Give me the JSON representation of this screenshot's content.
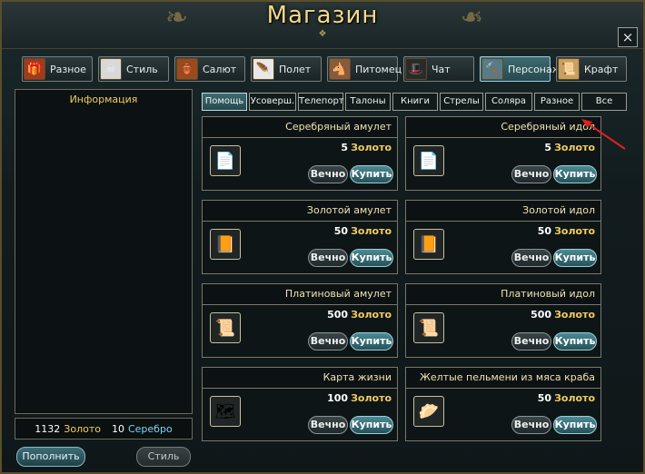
{
  "window": {
    "title": "Магазин",
    "close_label": "×"
  },
  "categories": [
    {
      "label": "Разное",
      "icon": "gift-icon",
      "glyph": "🎁",
      "color": "#a33a1e"
    },
    {
      "label": "Стиль",
      "icon": "skull-crossbones-icon",
      "glyph": "☠",
      "color": "#d8d8d8"
    },
    {
      "label": "Салют",
      "icon": "firework-pot-icon",
      "glyph": "🏺",
      "color": "#9a4a1e"
    },
    {
      "label": "Полет",
      "icon": "wing-icon",
      "glyph": "🪶",
      "color": "#e8e8e8"
    },
    {
      "label": "Питомец",
      "icon": "horse-head-icon",
      "glyph": "🐴",
      "color": "#8a5a3a"
    },
    {
      "label": "Чат",
      "icon": "witch-hat-icon",
      "glyph": "🎩",
      "color": "#2a2a2a"
    },
    {
      "label": "Персонаж",
      "icon": "hammer-icon",
      "glyph": "🔨",
      "color": "#5a7a84"
    },
    {
      "label": "Крафт",
      "icon": "scroll-icon",
      "glyph": "📜",
      "color": "#c8a060"
    }
  ],
  "active_category": 6,
  "info_panel": {
    "title": "Информация"
  },
  "money": {
    "gold_amount": "1132",
    "gold_label": "Золото",
    "silver_amount": "10",
    "silver_label": "Серебро"
  },
  "bottom_buttons": {
    "topup": "Пополнить",
    "style": "Стиль"
  },
  "sub_tabs": [
    "Помощь",
    "Усоверш.",
    "Телепорт",
    "Талоны",
    "Книги",
    "Стрелы",
    "Соляра",
    "Разное",
    "Все"
  ],
  "active_sub_tab": 0,
  "item_buttons": {
    "forever": "Вечно",
    "buy": "Купить"
  },
  "items": [
    {
      "name": "Серебряный амулет",
      "price": "5",
      "currency": "Золото",
      "icon": "silver-amulet-icon",
      "glyph": "📄"
    },
    {
      "name": "Серебряный идол",
      "price": "5",
      "currency": "Золото",
      "icon": "silver-idol-icon",
      "glyph": "📄"
    },
    {
      "name": "Золотой амулет",
      "price": "50",
      "currency": "Золото",
      "icon": "gold-amulet-icon",
      "glyph": "📙"
    },
    {
      "name": "Золотой идол",
      "price": "50",
      "currency": "Золото",
      "icon": "gold-idol-icon",
      "glyph": "📙"
    },
    {
      "name": "Платиновый амулет",
      "price": "500",
      "currency": "Золото",
      "icon": "platinum-amulet-icon",
      "glyph": "📜"
    },
    {
      "name": "Платиновый идол",
      "price": "500",
      "currency": "Золото",
      "icon": "platinum-idol-icon",
      "glyph": "📜"
    },
    {
      "name": "Карта жизни",
      "price": "100",
      "currency": "Золото",
      "icon": "life-map-icon",
      "glyph": "🗺"
    },
    {
      "name": "Желтые пельмени из мяса краба",
      "price": "50",
      "currency": "Золото",
      "icon": "dumpling-icon",
      "glyph": "🥟"
    }
  ]
}
